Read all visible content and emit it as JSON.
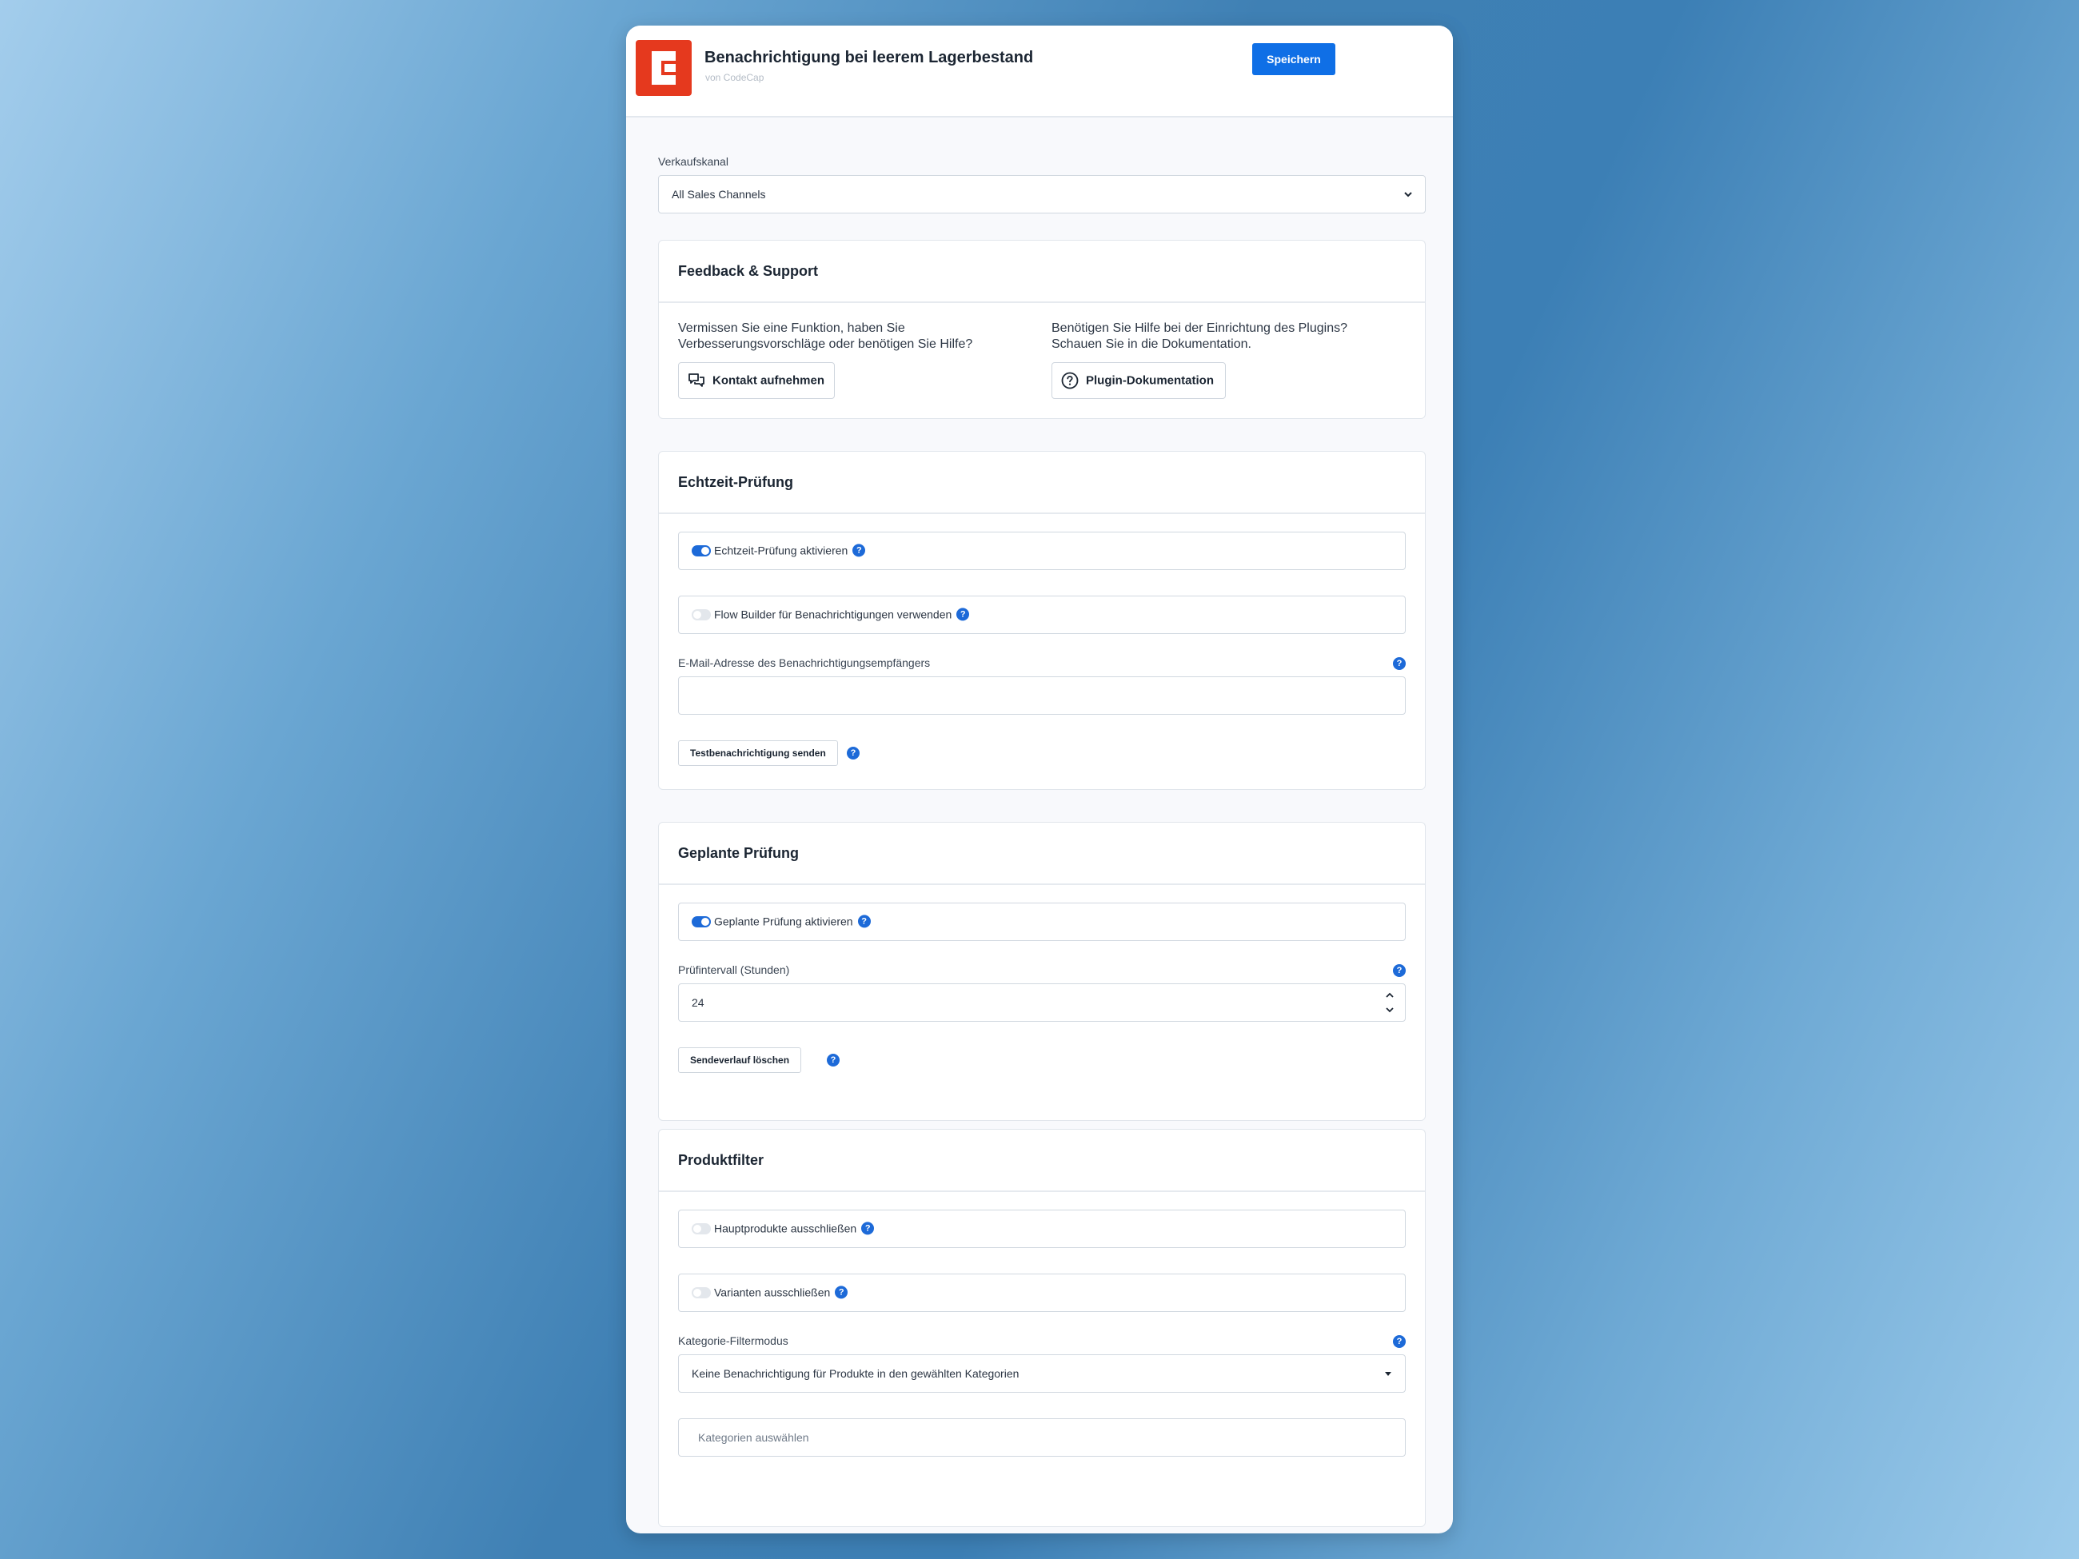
{
  "app": {
    "title": "Benachrichtigung bei leerem Lagerbestand",
    "vendor": "von CodeCap",
    "save_label": "Speichern",
    "brand_color": "#e5391e",
    "accent_color": "#0f6fe6"
  },
  "sales_channel": {
    "label": "Verkaufskanal",
    "value": "All Sales Channels"
  },
  "feedback": {
    "title": "Feedback & Support",
    "left_text_1": "Vermissen Sie eine Funktion, haben Sie",
    "left_text_2": "Verbesserungsvorschläge oder benötigen Sie Hilfe?",
    "contact_button": "Kontakt aufnehmen",
    "right_text_1": "Benötigen Sie Hilfe bei der Einrichtung des Plugins?",
    "right_text_2": "Schauen Sie in die Dokumentation.",
    "docs_button": "Plugin-Dokumentation"
  },
  "realtime": {
    "title": "Echtzeit-Prüfung",
    "toggle_realtime": {
      "label": "Echtzeit-Prüfung aktivieren",
      "on": true
    },
    "toggle_flow": {
      "label": "Flow Builder für Benachrichtigungen verwenden",
      "on": false
    },
    "email_label": "E-Mail-Adresse des Benachrichtigungsempfängers",
    "email_value": "",
    "test_button": "Testbenachrichtigung senden"
  },
  "scheduled": {
    "title": "Geplante Prüfung",
    "toggle_scheduled": {
      "label": "Geplante Prüfung aktivieren",
      "on": true
    },
    "interval_label": "Prüfintervall (Stunden)",
    "interval_value": "24",
    "clear_button": "Sendeverlauf löschen"
  },
  "product_filter": {
    "title": "Produktfilter",
    "toggle_main": {
      "label": "Hauptprodukte ausschließen",
      "on": false
    },
    "toggle_variants": {
      "label": "Varianten ausschließen",
      "on": false
    },
    "category_mode_label": "Kategorie-Filtermodus",
    "category_mode_value": "Keine Benachrichtigung für Produkte in den gewählten Kategorien",
    "category_placeholder": "Kategorien auswählen"
  },
  "help_glyph": "?"
}
